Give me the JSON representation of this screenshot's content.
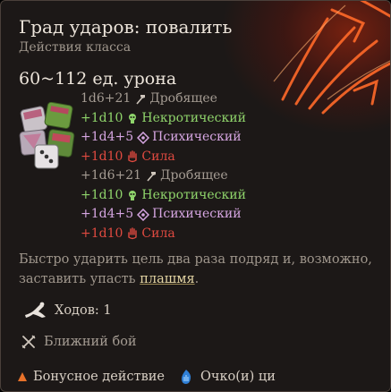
{
  "tooltip": {
    "title": "Град ударов: повалить",
    "subtitle": "Действия класса",
    "damage_total": "60~112 ед. урона",
    "damage_rows": [
      {
        "dice": "1d6+21",
        "type": "Дробящее",
        "icon": "bludgeoning-hammer-icon",
        "color": "#a59c93"
      },
      {
        "dice": "+1d10",
        "type": "Некротический",
        "icon": "necrotic-skull-icon",
        "color": "#8fd46b"
      },
      {
        "dice": "+1d4+5",
        "type": "Психический",
        "icon": "psychic-diamond-icon",
        "color": "#d6a6e2"
      },
      {
        "dice": "+1d10",
        "type": "Сила",
        "icon": "force-hand-icon",
        "color": "#e04a40"
      },
      {
        "dice": "+1d6+21",
        "type": "Дробящее",
        "icon": "bludgeoning-hammer-icon",
        "color": "#a59c93"
      },
      {
        "dice": "+1d10",
        "type": "Некротический",
        "icon": "necrotic-skull-icon",
        "color": "#8fd46b"
      },
      {
        "dice": "+1d4+5",
        "type": "Психический",
        "icon": "psychic-diamond-icon",
        "color": "#d6a6e2"
      },
      {
        "dice": "+1d10",
        "type": "Сила",
        "icon": "force-hand-icon",
        "color": "#e04a40"
      }
    ],
    "description_prefix": "Быстро ударить цель два раза подряд и, возможно, заставить упасть ",
    "description_keyword": "плашмя",
    "description_suffix": ".",
    "turns_label": "Ходов: 1",
    "range_label": "Ближний бой",
    "footer": {
      "bonus_action_label": "Бонусное действие",
      "ki_label": "Очко(и) ци"
    }
  }
}
